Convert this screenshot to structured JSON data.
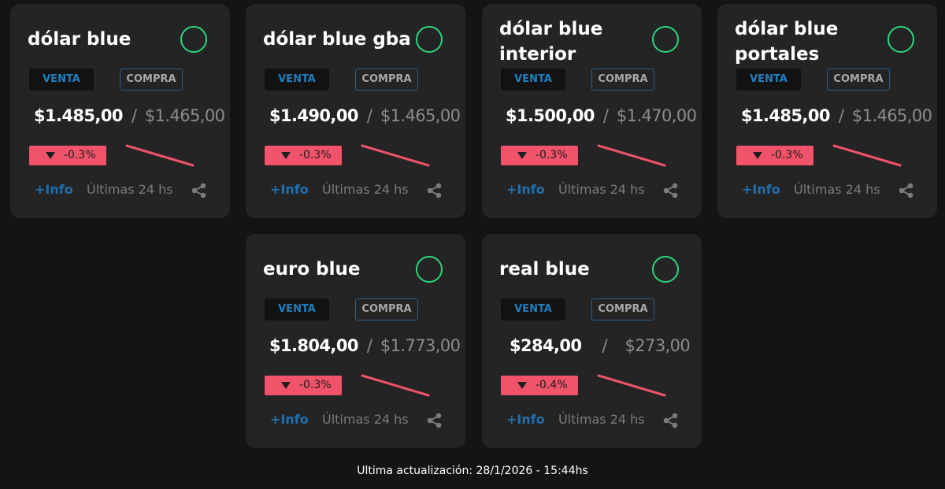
{
  "cards": [
    {
      "title": "dólar blue",
      "venta_label": "VENTA",
      "compra_label": "COMPRA",
      "venta_price": "$1.485,00",
      "separator": "/",
      "compra_price": "$1.465,00",
      "change": "-0.3%",
      "info_label": "+Info",
      "period_label": "Últimas 24 hs",
      "trend": "down",
      "share_icon": "share-icon"
    },
    {
      "title": "dólar blue gba",
      "venta_label": "VENTA",
      "compra_label": "COMPRA",
      "venta_price": "$1.490,00",
      "separator": "/",
      "compra_price": "$1.465,00",
      "change": "-0.3%",
      "info_label": "+Info",
      "period_label": "Últimas 24 hs",
      "trend": "down",
      "share_icon": "share-icon"
    },
    {
      "title": "dólar blue interior",
      "venta_label": "VENTA",
      "compra_label": "COMPRA",
      "venta_price": "$1.500,00",
      "separator": "/",
      "compra_price": "$1.470,00",
      "change": "-0.3%",
      "info_label": "+Info",
      "period_label": "Últimas 24 hs",
      "trend": "down",
      "share_icon": "share-icon"
    },
    {
      "title": "dólar blue portales",
      "venta_label": "VENTA",
      "compra_label": "COMPRA",
      "venta_price": "$1.485,00",
      "separator": "/",
      "compra_price": "$1.465,00",
      "change": "-0.3%",
      "info_label": "+Info",
      "period_label": "Últimas 24 hs",
      "trend": "down",
      "share_icon": "share-icon"
    },
    {
      "title": "euro blue",
      "venta_label": "VENTA",
      "compra_label": "COMPRA",
      "venta_price": "$1.804,00",
      "separator": "/",
      "compra_price": "$1.773,00",
      "change": "-0.3%",
      "info_label": "+Info",
      "period_label": "Últimas 24 hs",
      "trend": "down",
      "share_icon": "share-icon"
    },
    {
      "title": "real blue",
      "venta_label": "VENTA",
      "compra_label": "COMPRA",
      "venta_price": "$284,00",
      "separator": "/",
      "compra_price": "$273,00",
      "change": "-0.4%",
      "info_label": "+Info",
      "period_label": "Últimas 24 hs",
      "trend": "down",
      "share_icon": "share-icon"
    }
  ],
  "footer": {
    "updated_text": "Ultima actualización: 28/1/2026 - 15:44hs"
  },
  "colors": {
    "background": "#141414",
    "card": "#242424",
    "status_ring": "#2bd67b",
    "negative": "#f0536a",
    "link": "#1f6fb0",
    "venta_tab_text": "#1f7fbf"
  }
}
